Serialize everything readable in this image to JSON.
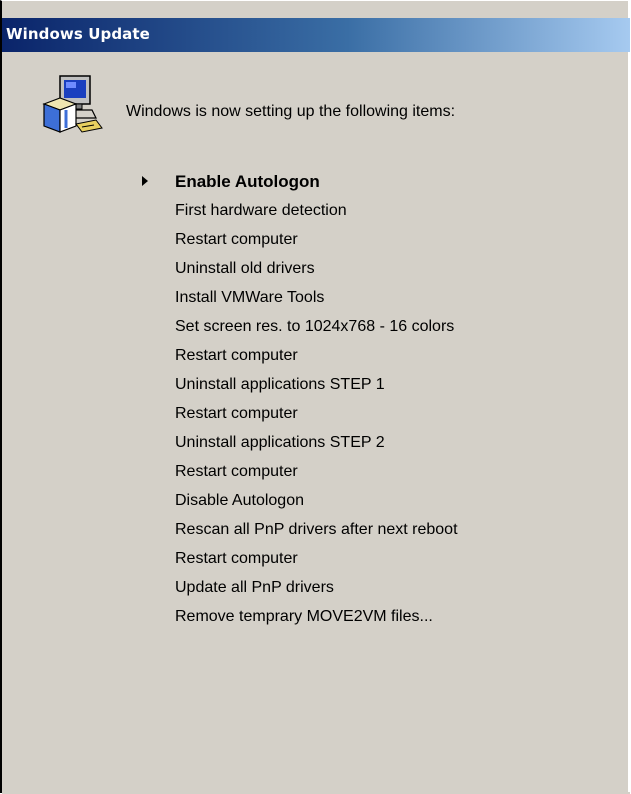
{
  "window": {
    "title": "Windows Update"
  },
  "intro": {
    "text": "Windows is now setting up the following items:",
    "icon": "computer-setup-icon"
  },
  "current_item_index": 0,
  "current_item_indicator_icon": "play-arrow-icon",
  "items": [
    {
      "label": "Enable Autologon"
    },
    {
      "label": "First hardware detection"
    },
    {
      "label": "Restart computer"
    },
    {
      "label": "Uninstall old drivers"
    },
    {
      "label": "Install VMWare Tools"
    },
    {
      "label": "Set screen res. to 1024x768 - 16 colors"
    },
    {
      "label": "Restart computer"
    },
    {
      "label": "Uninstall applications STEP 1"
    },
    {
      "label": "Restart computer"
    },
    {
      "label": "Uninstall applications STEP 2"
    },
    {
      "label": "Restart computer"
    },
    {
      "label": "Disable Autologon"
    },
    {
      "label": "Rescan all PnP drivers after next reboot"
    },
    {
      "label": "Restart computer"
    },
    {
      "label": "Update all PnP drivers"
    },
    {
      "label": "Remove temprary MOVE2VM files..."
    }
  ],
  "colors": {
    "titlebar_start": "#0a246a",
    "titlebar_end": "#a6caf0",
    "window_background": "#d4d0c8"
  }
}
